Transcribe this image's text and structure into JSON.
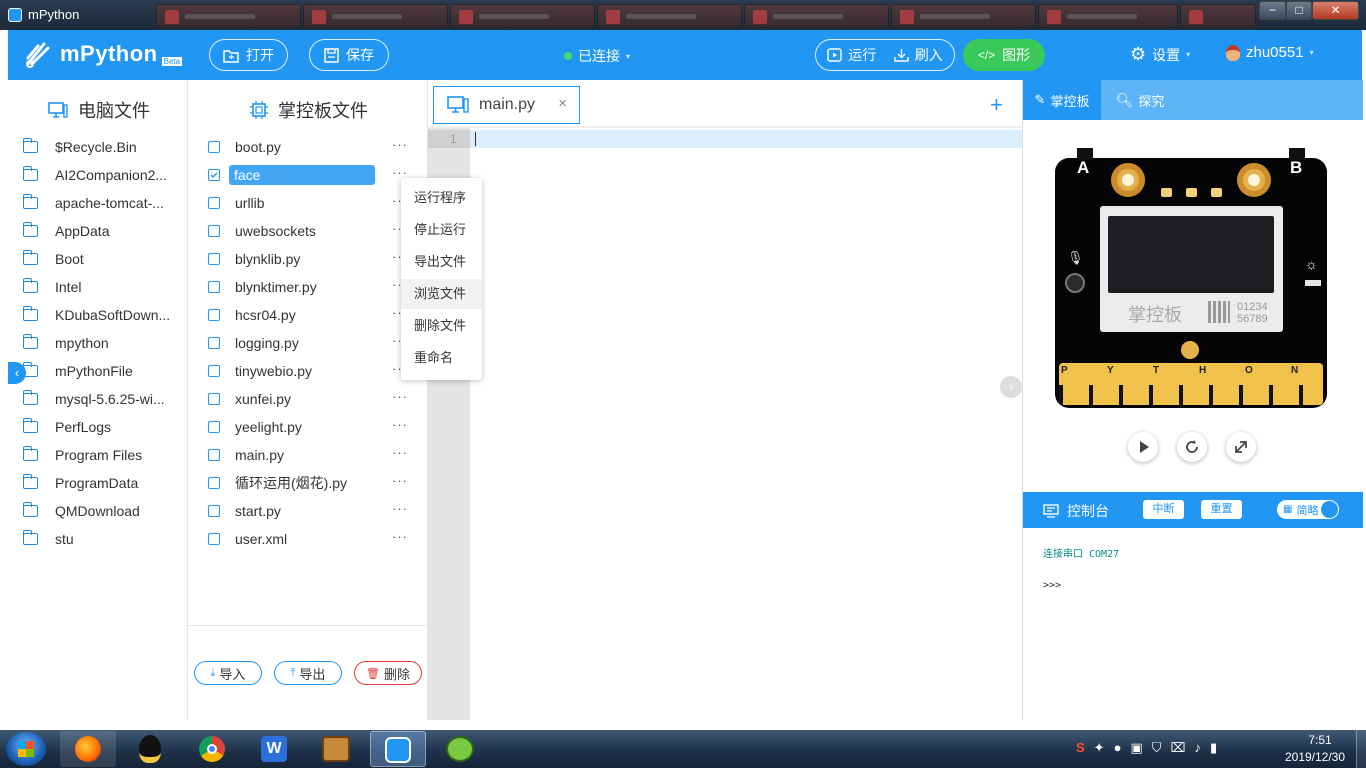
{
  "window": {
    "title": "mPython",
    "controls": {
      "minimize": "−",
      "maximize": "□",
      "close": "✕"
    }
  },
  "header": {
    "logo": "mPython",
    "logo_badge": "Beta",
    "open_label": "打开",
    "save_label": "保存",
    "status_label": "已连接",
    "run_label": "运行",
    "flash_label": "刷入",
    "blocks_label": "图形",
    "settings_label": "设置",
    "user_label": "zhu0551"
  },
  "left_panel": {
    "title": "电脑文件",
    "items": [
      "$Recycle.Bin",
      "AI2Companion2...",
      "apache-tomcat-...",
      "AppData",
      "Boot",
      "Intel",
      "KDubaSoftDown...",
      "mpython",
      "mPythonFile",
      "mysql-5.6.25-wi...",
      "PerfLogs",
      "Program Files",
      "ProgramData",
      "QMDownload",
      "stu"
    ]
  },
  "mid_panel": {
    "title": "掌控板文件",
    "items": [
      {
        "name": "boot.py",
        "checked": false,
        "selected": false
      },
      {
        "name": "face",
        "checked": true,
        "selected": true
      },
      {
        "name": "urllib",
        "checked": false,
        "selected": false
      },
      {
        "name": "uwebsockets",
        "checked": false,
        "selected": false
      },
      {
        "name": "blynklib.py",
        "checked": false,
        "selected": false
      },
      {
        "name": "blynktimer.py",
        "checked": false,
        "selected": false
      },
      {
        "name": "hcsr04.py",
        "checked": false,
        "selected": false
      },
      {
        "name": "logging.py",
        "checked": false,
        "selected": false
      },
      {
        "name": "tinywebio.py",
        "checked": false,
        "selected": false
      },
      {
        "name": "xunfei.py",
        "checked": false,
        "selected": false
      },
      {
        "name": "yeelight.py",
        "checked": false,
        "selected": false
      },
      {
        "name": "main.py",
        "checked": false,
        "selected": false
      },
      {
        "name": "循环运用(烟花).py",
        "checked": false,
        "selected": false
      },
      {
        "name": "start.py",
        "checked": false,
        "selected": false
      },
      {
        "name": "user.xml",
        "checked": false,
        "selected": false
      }
    ],
    "more_glyph": "···",
    "import_label": "导入",
    "export_label": "导出",
    "delete_label": "删除"
  },
  "context_menu": {
    "items": [
      "运行程序",
      "停止运行",
      "导出文件",
      "浏览文件",
      "删除文件",
      "重命名"
    ],
    "hovered": "浏览文件"
  },
  "editor": {
    "tab_label": "main.py",
    "tab_close": "×",
    "add_glyph": "+",
    "line_number": "1"
  },
  "right_panel": {
    "tabs": [
      "掌控板",
      "探究"
    ],
    "board": {
      "label_a": "A",
      "label_b": "B",
      "brand_text": "掌控板",
      "code_line1": "01234",
      "code_line2": "56789",
      "pins": [
        "P",
        "Y",
        "T",
        "H",
        "O",
        "N"
      ]
    },
    "console": {
      "title": "控制台",
      "interrupt_label": "中断",
      "reset_label": "重置",
      "simple_label": "简略",
      "line1": "连接串口 COM27",
      "line2": ">>>"
    }
  },
  "taskbar": {
    "time": "7:51",
    "date": "2019/12/30"
  },
  "colors": {
    "primary": "#2196f3",
    "green": "#3ac85a",
    "selected": "#43a6f5",
    "delete": "#e53935"
  }
}
